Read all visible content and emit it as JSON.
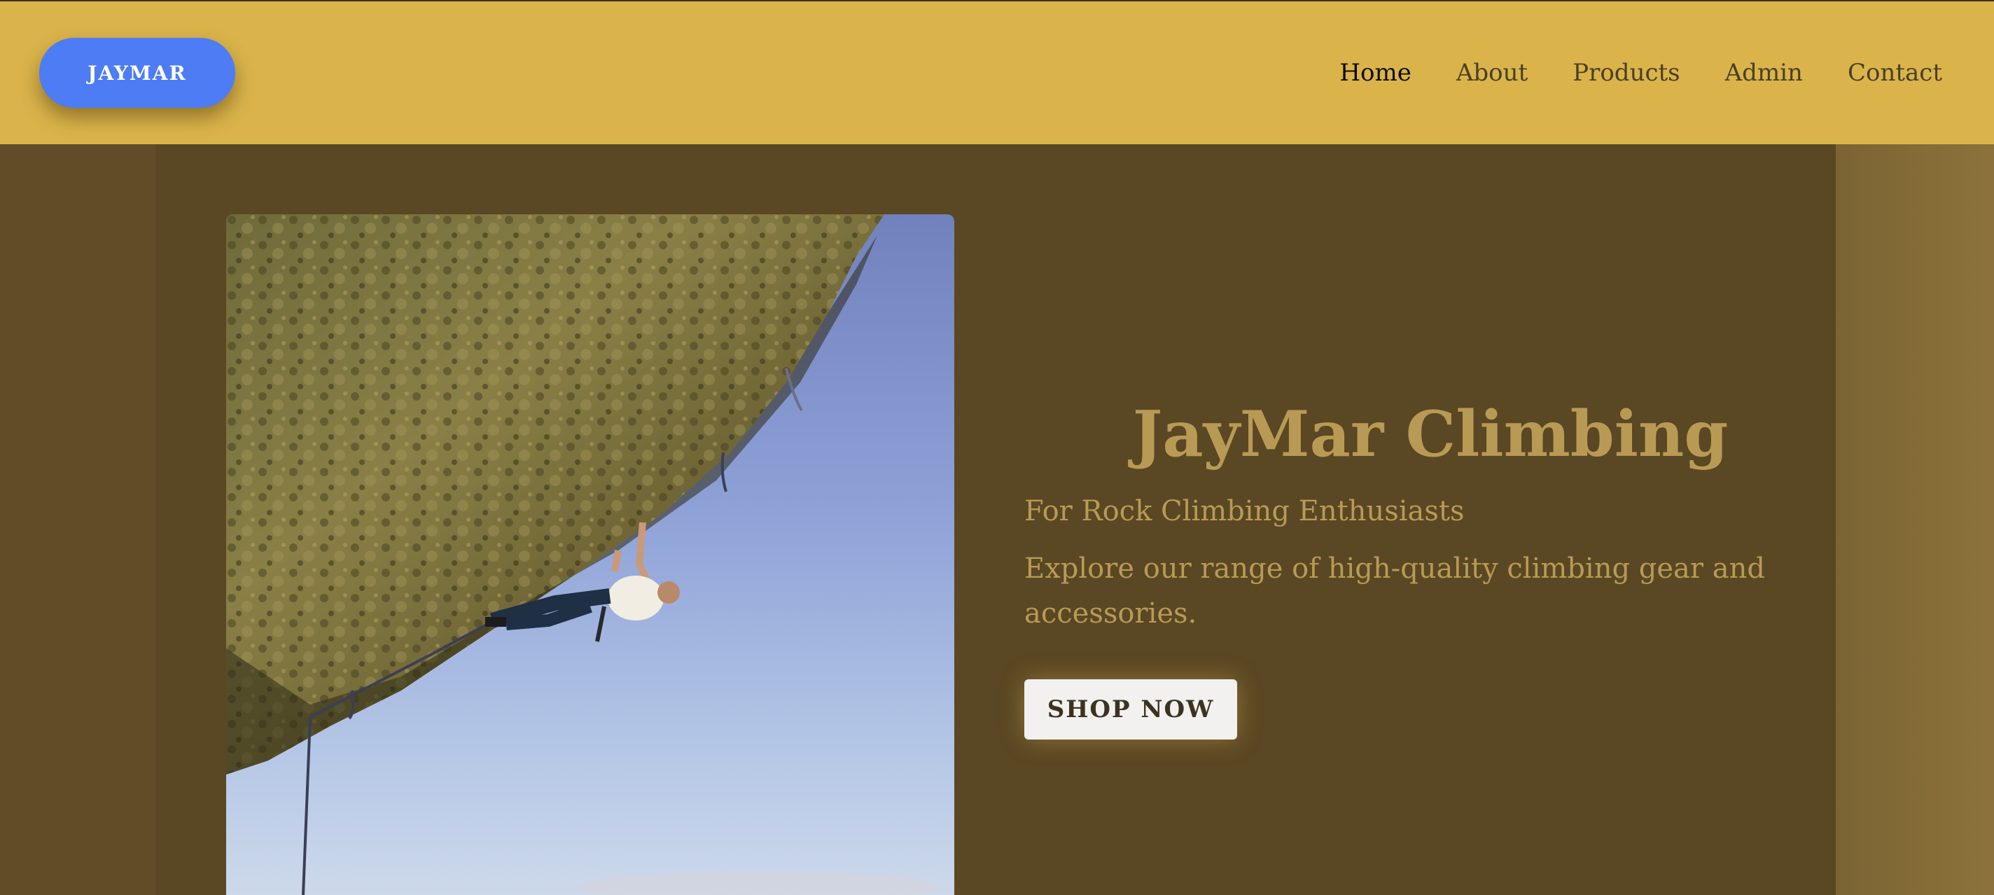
{
  "header": {
    "logo": "JAYMAR",
    "nav": [
      {
        "label": "Home",
        "active": true
      },
      {
        "label": "About",
        "active": false
      },
      {
        "label": "Products",
        "active": false
      },
      {
        "label": "Admin",
        "active": false
      },
      {
        "label": "Contact",
        "active": false
      }
    ]
  },
  "hero": {
    "title": "JayMar Climbing",
    "subtitle": "For Rock Climbing Enthusiasts",
    "description": "Explore our range of high-quality climbing gear and accessories.",
    "cta_label": "SHOP NOW",
    "image_icon": "rock-climber-photo"
  },
  "colors": {
    "header_bg": "#dab44a",
    "logo_bg": "#4d7cf5",
    "main_bg": "#5a4723",
    "accent_text": "#b99a55",
    "button_bg": "#f2f1ef"
  }
}
